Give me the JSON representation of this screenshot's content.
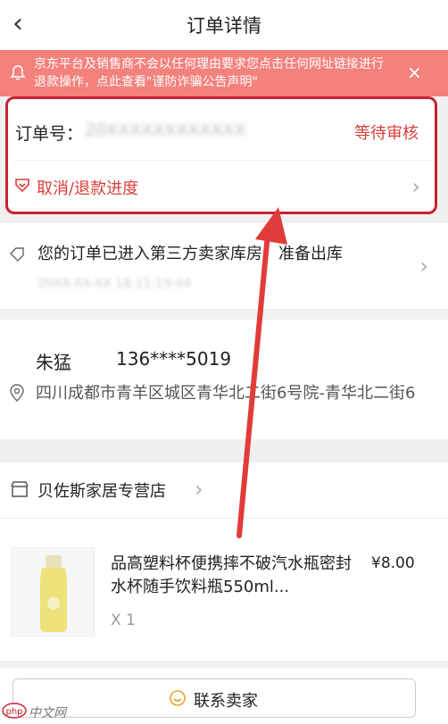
{
  "header": {
    "back_icon": "chevron-left-icon",
    "title": "订单详情"
  },
  "notice": {
    "bell_icon": "bell-icon",
    "text": "京东平台及销售商不会以任何理由要求您点击任何网址链接进行退款操作，点此查看\"谨防诈骗公告声明\"",
    "close_label": "×"
  },
  "order": {
    "number_label": "订单号：",
    "number_value": "20XXXXXXXXXXXX",
    "status": "等待审核",
    "refund_icon": "refund-icon",
    "refund_label": "取消/退款进度",
    "chevron": "›"
  },
  "tracking": {
    "icon": "tag-icon",
    "text": "您的订单已进入第三方卖家库房，准备出库",
    "time": "20XX-XX-XX 18:11:19:04",
    "chevron": "›"
  },
  "address": {
    "name": "朱猛",
    "phone": "136****5019",
    "location_icon": "location-pin-icon",
    "detail": "四川成都市青羊区城区青华北二街6号院-青华北二街6"
  },
  "store": {
    "icon": "store-icon",
    "name": "贝佐斯家居专营店",
    "chevron": "›"
  },
  "product": {
    "name": "品高塑料杯便携摔不破汽水瓶密封水杯随手饮料瓶550ml...",
    "price": "¥8.00",
    "qty": "X 1"
  },
  "footer": {
    "contact_icon": "chat-icon",
    "contact_label": "联系卖家"
  },
  "watermark": {
    "text": "中文网"
  },
  "colors": {
    "accent": "#d9403a",
    "notice_bg": "#f3817c",
    "highlight_border": "#c8202e"
  }
}
